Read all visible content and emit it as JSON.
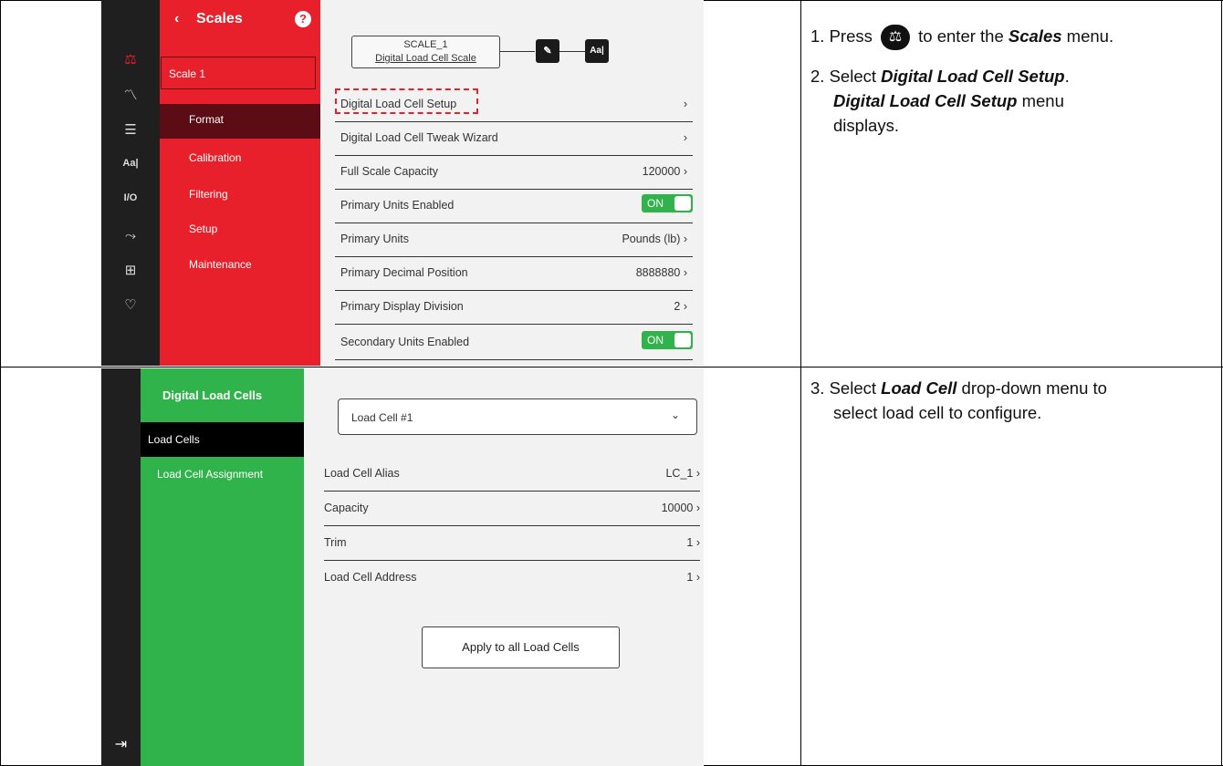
{
  "screen1": {
    "icons": [
      "scale-icon",
      "signal-icon",
      "list-icon",
      "text-format-icon",
      "io-icon",
      "network-icon",
      "hierarchy-icon",
      "heart-monitor-icon"
    ],
    "menu_title": "Scales",
    "back_glyph": "‹",
    "help_glyph": "?",
    "scale_selector": "Scale 1",
    "menu_items": [
      "Format",
      "Calibration",
      "Filtering",
      "Setup",
      "Maintenance"
    ],
    "scale_name": "SCALE_1",
    "scale_type": "Digital Load Cell Scale",
    "edit_glyph": "✎",
    "aa_label": "Aa|",
    "rows": [
      {
        "label": "Digital Load Cell Setup",
        "value": "›"
      },
      {
        "label": "Digital Load Cell Tweak Wizard",
        "value": "›"
      },
      {
        "label": "Full Scale Capacity",
        "value": "120000 ›"
      },
      {
        "label": "Primary Units Enabled",
        "value": "ON"
      },
      {
        "label": "Primary Units",
        "value": "Pounds (lb) ›"
      },
      {
        "label": "Primary Decimal Position",
        "value": "8888880 ›"
      },
      {
        "label": "Primary Display Division",
        "value": "2 ›"
      },
      {
        "label": "Secondary Units Enabled",
        "value": "ON"
      }
    ],
    "accent_color": "#e8202b"
  },
  "screen2": {
    "menu_title": "Digital Load Cells",
    "menu_items": [
      "Load Cells",
      "Load Cell Assignment"
    ],
    "load_cell_select": "Load Cell #1",
    "rows": [
      {
        "label": "Load Cell Alias",
        "value": "LC_1 ›"
      },
      {
        "label": "Capacity",
        "value": "10000 ›"
      },
      {
        "label": "Trim",
        "value": "1 ›"
      },
      {
        "label": "Load Cell Address",
        "value": "1 ›"
      }
    ],
    "apply_button": "Apply to all Load Cells",
    "accent_color": "#2fb34a"
  },
  "instructions": {
    "step1_num": "1.",
    "step1_a": "Press",
    "step1_b": "to enter the",
    "step1_bold": "Scales",
    "step1_c": "menu.",
    "step2_num": "2.",
    "step2_a": "Select",
    "step2_bold1": "Digital Load Cell Setup",
    "step2_b": ".",
    "step2_bold2": "Digital Load Cell Setup",
    "step2_c": "menu",
    "step2_d": "displays.",
    "step3_num": "3.",
    "step3_a": "Select",
    "step3_bold": "Load Cell",
    "step3_b": "drop-down menu to",
    "step3_c": "select load cell to configure."
  }
}
